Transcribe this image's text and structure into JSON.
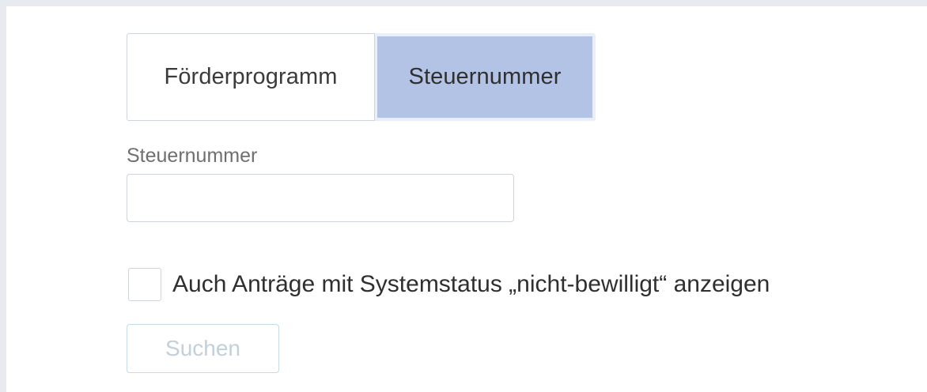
{
  "tabs": [
    {
      "label": "Förderprogramm",
      "selected": false
    },
    {
      "label": "Steuernummer",
      "selected": true
    }
  ],
  "form": {
    "field_label": "Steuernummer",
    "field_value": "",
    "field_placeholder": "",
    "checkbox_label": "Auch Anträge mit Systemstatus „nicht-bewilligt“ anzeigen",
    "checkbox_checked": false,
    "search_button_label": "Suchen",
    "search_button_disabled": true
  },
  "colors": {
    "selected_tab_bg": "#b3c3e5",
    "page_bg": "#ffffff",
    "outer_bg": "#e7eaee",
    "disabled_button_text": "#c1d0da"
  }
}
